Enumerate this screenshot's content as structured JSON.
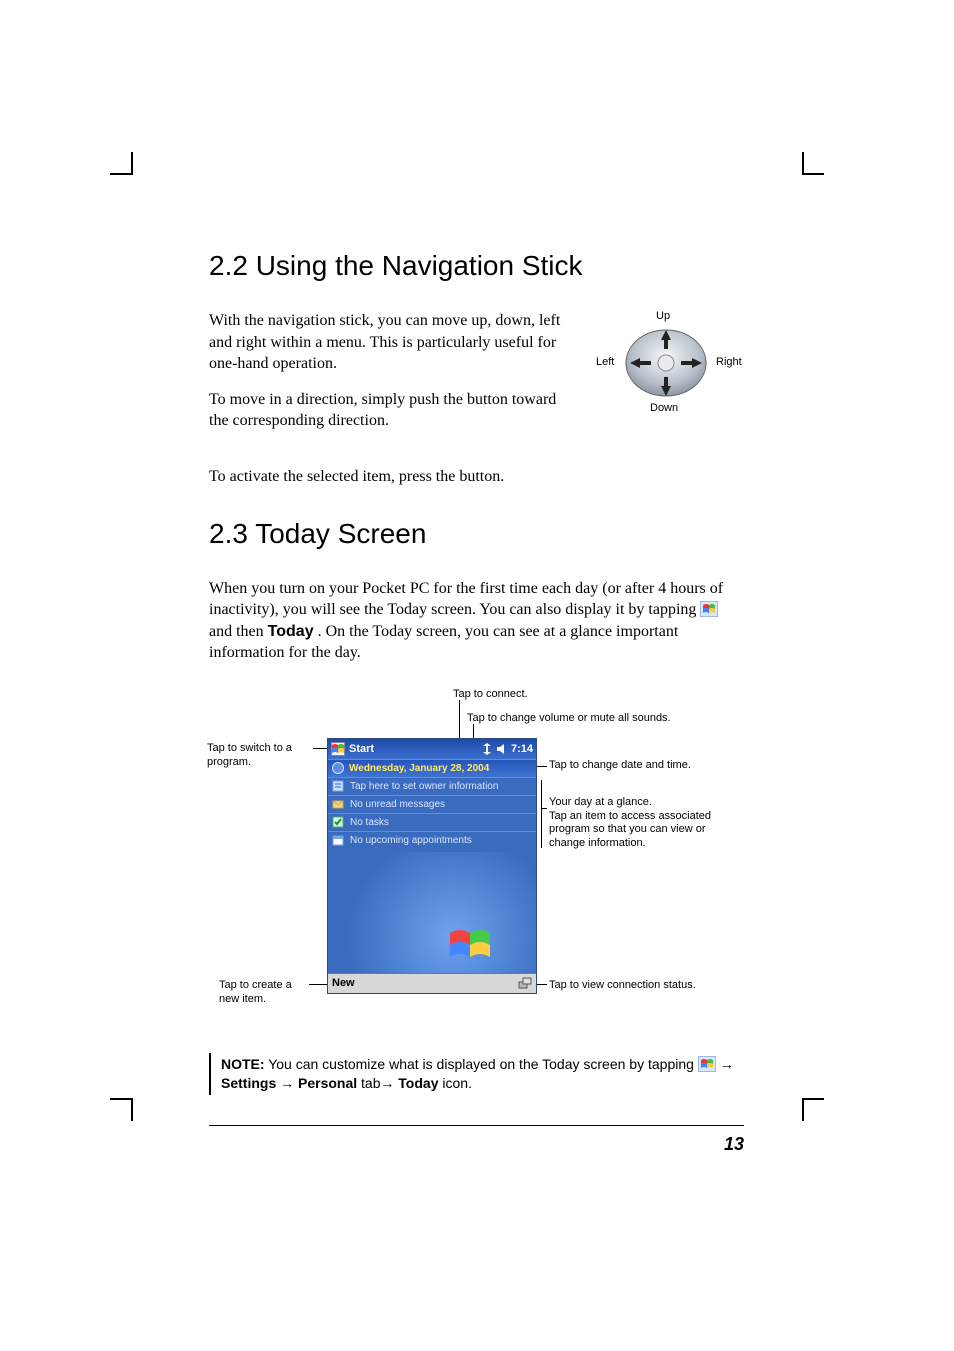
{
  "sections": {
    "nav_heading": "2.2  Using the Navigation Stick",
    "today_heading": "2.3  Today Screen"
  },
  "nav_text": {
    "p1": "With the navigation stick, you can move up, down, left and right within a menu. This is particularly useful for one-hand operation.",
    "p2": "To move in a direction, simply push the button toward the corresponding direction.",
    "p3": "To activate the selected item, press the button."
  },
  "nav_diagram": {
    "up": "Up",
    "down": "Down",
    "left": "Left",
    "right": "Right"
  },
  "today_text": {
    "p1a": "When you turn on your Pocket PC for the first time each day (or after 4 hours of inactivity), you will see the Today screen. You can also display it by tapping ",
    "p1b": " and then ",
    "today_word": "Today",
    "p1c": ". On the Today screen, you can see at a glance important information for the day."
  },
  "callouts": {
    "connect": "Tap to connect.",
    "volume": "Tap to change volume or mute all sounds.",
    "switch_program_l1": "Tap to switch to a",
    "switch_program_l2": "program.",
    "date_time": "Tap to change date and time.",
    "glance_l1": "Your day at a glance.",
    "glance_l2": "Tap an item to access associated",
    "glance_l3": "program so that you can view or",
    "glance_l4": "change information.",
    "new_item_l1": "Tap to create a",
    "new_item_l2": "new item.",
    "conn_status": "Tap to view connection status."
  },
  "device": {
    "title": "Start",
    "time": "7:14",
    "date": "Wednesday, January 28, 2004",
    "rows": {
      "owner": "Tap here to set owner information",
      "messages": "No unread messages",
      "tasks": "No tasks",
      "appointments": "No upcoming appointments"
    },
    "new_button": "New"
  },
  "note": {
    "label": "NOTE:",
    "text_a": "  You can customize what is displayed on the Today screen by tapping ",
    "arrow": " → ",
    "settings": "Settings",
    "personal": "Personal",
    "tab_word": " tab ",
    "today": "Today",
    "icon_word": " icon."
  },
  "page_number": "13"
}
